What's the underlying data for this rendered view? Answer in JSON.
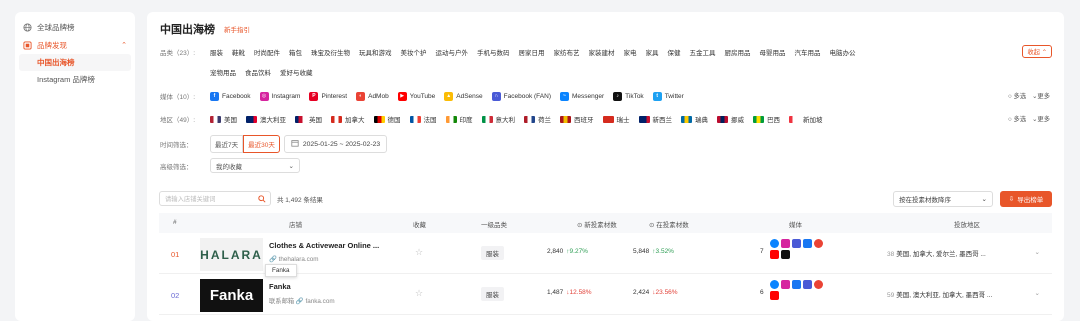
{
  "sidebar": {
    "global_label": "全球品牌榜",
    "brand_label": "品牌发现",
    "sub_active": "中国出海榜",
    "sub_ig": "Instagram 品牌榜"
  },
  "header": {
    "title": "中国出海榜",
    "guide": "新手指引",
    "collapse": "收起"
  },
  "filters": {
    "category_label": "品类（23）:",
    "categories": [
      "服装",
      "鞋靴",
      "时尚配件",
      "箱包",
      "珠宝及衍生物",
      "玩具和游戏",
      "美妆个护",
      "运动与户外",
      "手机与数码",
      "居家日用",
      "家纺布艺",
      "家装建材",
      "家电",
      "家具",
      "保健",
      "五金工具",
      "厨房用品",
      "母婴用品",
      "汽车用品",
      "电脑办公"
    ],
    "categories2": [
      "宠物用品",
      "食品饮料",
      "爱好与收藏"
    ],
    "media_label": "媒体（10）:",
    "media": [
      {
        "name": "Facebook",
        "color": "#1877f2",
        "glyph": "f"
      },
      {
        "name": "Instagram",
        "color": "#d6249f",
        "glyph": "◎"
      },
      {
        "name": "Pinterest",
        "color": "#e60023",
        "glyph": "P"
      },
      {
        "name": "AdMob",
        "color": "#ea4335",
        "glyph": "◐"
      },
      {
        "name": "YouTube",
        "color": "#ff0000",
        "glyph": "▶"
      },
      {
        "name": "AdSense",
        "color": "#fbbc05",
        "glyph": "▲"
      },
      {
        "name": "Facebook (FAN)",
        "color": "#4a5ad6",
        "glyph": "∩"
      },
      {
        "name": "Messenger",
        "color": "#0a84ff",
        "glyph": "~"
      },
      {
        "name": "TikTok",
        "color": "#111111",
        "glyph": "♪"
      },
      {
        "name": "Twitter",
        "color": "#1da1f2",
        "glyph": "t"
      }
    ],
    "region_label": "地区（49）:",
    "regions": [
      {
        "name": "美国",
        "colors": [
          "#b22234",
          "#fff",
          "#3c3b6e"
        ]
      },
      {
        "name": "澳大利亚",
        "colors": [
          "#012169",
          "#012169",
          "#e4002b"
        ]
      },
      {
        "name": "英国",
        "colors": [
          "#012169",
          "#c8102e",
          "#fff"
        ]
      },
      {
        "name": "加拿大",
        "colors": [
          "#d52b1e",
          "#fff",
          "#d52b1e"
        ]
      },
      {
        "name": "德国",
        "colors": [
          "#000",
          "#dd0000",
          "#ffce00"
        ]
      },
      {
        "name": "法国",
        "colors": [
          "#0055a4",
          "#fff",
          "#ef4135"
        ]
      },
      {
        "name": "印度",
        "colors": [
          "#ff9933",
          "#fff",
          "#138808"
        ]
      },
      {
        "name": "意大利",
        "colors": [
          "#009246",
          "#fff",
          "#ce2b37"
        ]
      },
      {
        "name": "荷兰",
        "colors": [
          "#ae1c28",
          "#fff",
          "#21468b"
        ]
      },
      {
        "name": "西班牙",
        "colors": [
          "#aa151b",
          "#f1bf00",
          "#aa151b"
        ]
      },
      {
        "name": "瑞士",
        "colors": [
          "#d52b1e",
          "#d52b1e",
          "#d52b1e"
        ]
      },
      {
        "name": "新西兰",
        "colors": [
          "#012169",
          "#012169",
          "#c8102e"
        ]
      },
      {
        "name": "瑞典",
        "colors": [
          "#006aa7",
          "#fecc00",
          "#006aa7"
        ]
      },
      {
        "name": "挪威",
        "colors": [
          "#ba0c2f",
          "#00205b",
          "#ba0c2f"
        ]
      },
      {
        "name": "巴西",
        "colors": [
          "#009c3b",
          "#ffdf00",
          "#009c3b"
        ]
      },
      {
        "name": "新加坡",
        "colors": [
          "#ef3340",
          "#fff",
          "#fff"
        ]
      }
    ],
    "multi": "多选",
    "more": "更多",
    "time_label": "时间筛选：",
    "time_7": "最近7天",
    "time_30": "最近30天",
    "date_range": "2025-01-25 ~ 2025-02-23",
    "adv_label": "高级筛选：",
    "fav_select": "我的收藏"
  },
  "toolbar": {
    "search_placeholder": "请输入店铺关键词",
    "total": "共 1,492 条结果",
    "sort": "按在投素材数降序",
    "export": "导出榜单"
  },
  "table": {
    "headers": [
      "#",
      "店铺",
      "收藏",
      "一级品类",
      "新投素材数",
      "在投素材数",
      "媒体",
      "投放地区"
    ],
    "rows": [
      {
        "rank": "01",
        "logo": "HALARA",
        "name": "Clothes & Activewear Online ...",
        "domain": "thehalara.com",
        "category": "服装",
        "new": "2,840",
        "new_pct": "9.27%",
        "new_dir": "up",
        "active": "5,848",
        "active_pct": "3.52%",
        "active_dir": "up",
        "media_count": "7",
        "region_count": "38",
        "regions": "美国, 加拿大, 爱尔兰, 墨西哥 ..."
      },
      {
        "rank": "02",
        "logo": "Fanka",
        "name": "Fanka",
        "domain": "fanka.com",
        "domain_prefix": "联系邮箱",
        "category": "服装",
        "new": "1,487",
        "new_pct": "12.58%",
        "new_dir": "down",
        "active": "2,424",
        "active_pct": "23.56%",
        "active_dir": "down",
        "media_count": "6",
        "region_count": "59",
        "regions": "美国, 澳大利亚, 加拿大, 墨西哥 ..."
      }
    ],
    "tooltip": "Fanka"
  }
}
